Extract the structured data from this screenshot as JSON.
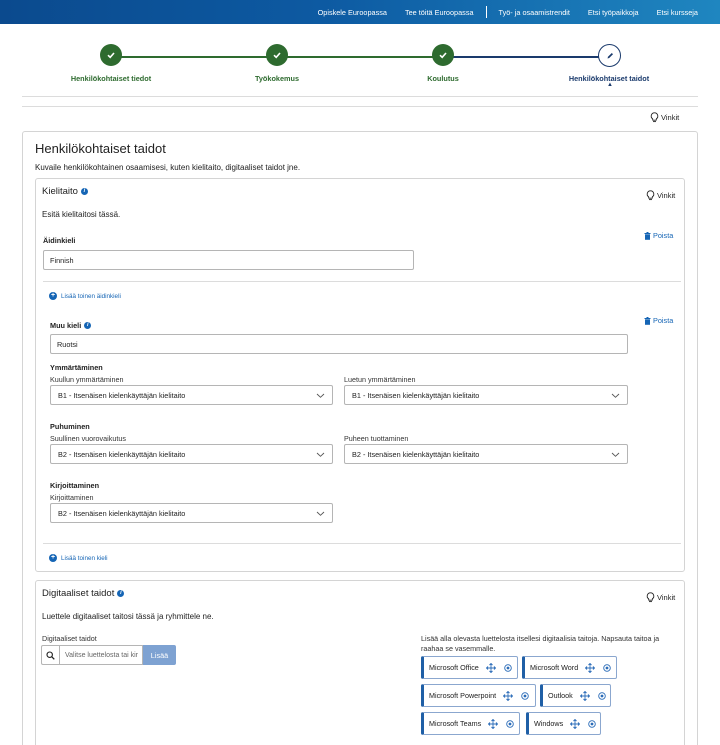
{
  "topnav": {
    "items": [
      "Opiskele Euroopassa",
      "Tee töitä Euroopassa",
      "Työ- ja osaamistrendit",
      "Etsi työpaikkoja",
      "Etsi kursseja"
    ]
  },
  "stepper": {
    "steps": [
      {
        "label": "Henkilökohtaiset tiedot",
        "state": "done"
      },
      {
        "label": "Työkokemus",
        "state": "done"
      },
      {
        "label": "Koulutus",
        "state": "done"
      },
      {
        "label": "Henkilökohtaiset taidot",
        "state": "current"
      }
    ],
    "colors": {
      "done": "#2e6b2f",
      "current": "#1a3a6c"
    }
  },
  "vinkit_label": "Vinkit",
  "section": {
    "title": "Henkilökohtaiset taidot",
    "description": "Kuvaile henkilökohtainen osaamisesi, kuten kielitaito, digitaaliset taidot jne."
  },
  "kielitaito": {
    "title": "Kielitaito",
    "intro": "Esitä kielitaitosi tässä.",
    "poista_label": "Poista",
    "aidinkieli_label": "Äidinkieli",
    "aidinkieli_value": "Finnish",
    "add_native_label": "Lisää toinen äidinkieli",
    "muu_kieli_label": "Muu kieli",
    "muu_kieli_value": "Ruotsi",
    "ymmartaminen": {
      "heading": "Ymmärtäminen",
      "kuullun_label": "Kuullun ymmärtäminen",
      "kuullun_value": "B1 - Itsenäisen kielenkäyttäjän kielitaito",
      "luetun_label": "Luetun ymmärtäminen",
      "luetun_value": "B1 - Itsenäisen kielenkäyttäjän kielitaito"
    },
    "puhuminen": {
      "heading": "Puhuminen",
      "vuoro_label": "Suullinen vuorovaikutus",
      "vuoro_value": "B2 - Itsenäisen kielenkäyttäjän kielitaito",
      "tuotto_label": "Puheen tuottaminen",
      "tuotto_value": "B2 - Itsenäisen kielenkäyttäjän kielitaito"
    },
    "kirjoittaminen": {
      "heading": "Kirjoittaminen",
      "label": "Kirjoittaminen",
      "value": "B2 - Itsenäisen kielenkäyttäjän kielitaito"
    },
    "add_language_label": "Lisää toinen kieli"
  },
  "digitaaliset": {
    "title": "Digitaaliset taidot",
    "intro": "Luettele digitaaliset taitosi tässä ja ryhmittele ne.",
    "field_label": "Digitaaliset taidot",
    "search_placeholder": "Valitse luettelosta tai kir",
    "add_button": "Lisää",
    "help_text": "Lisää alla olevasta luettelosta itsellesi digitaalisia taitoja. Napsauta taitoa ja raahaa se vasemmalle.",
    "chips": [
      "Microsoft Office",
      "Microsoft Word",
      "Microsoft Powerpoint",
      "Outlook",
      "Microsoft Teams",
      "Windows"
    ]
  }
}
